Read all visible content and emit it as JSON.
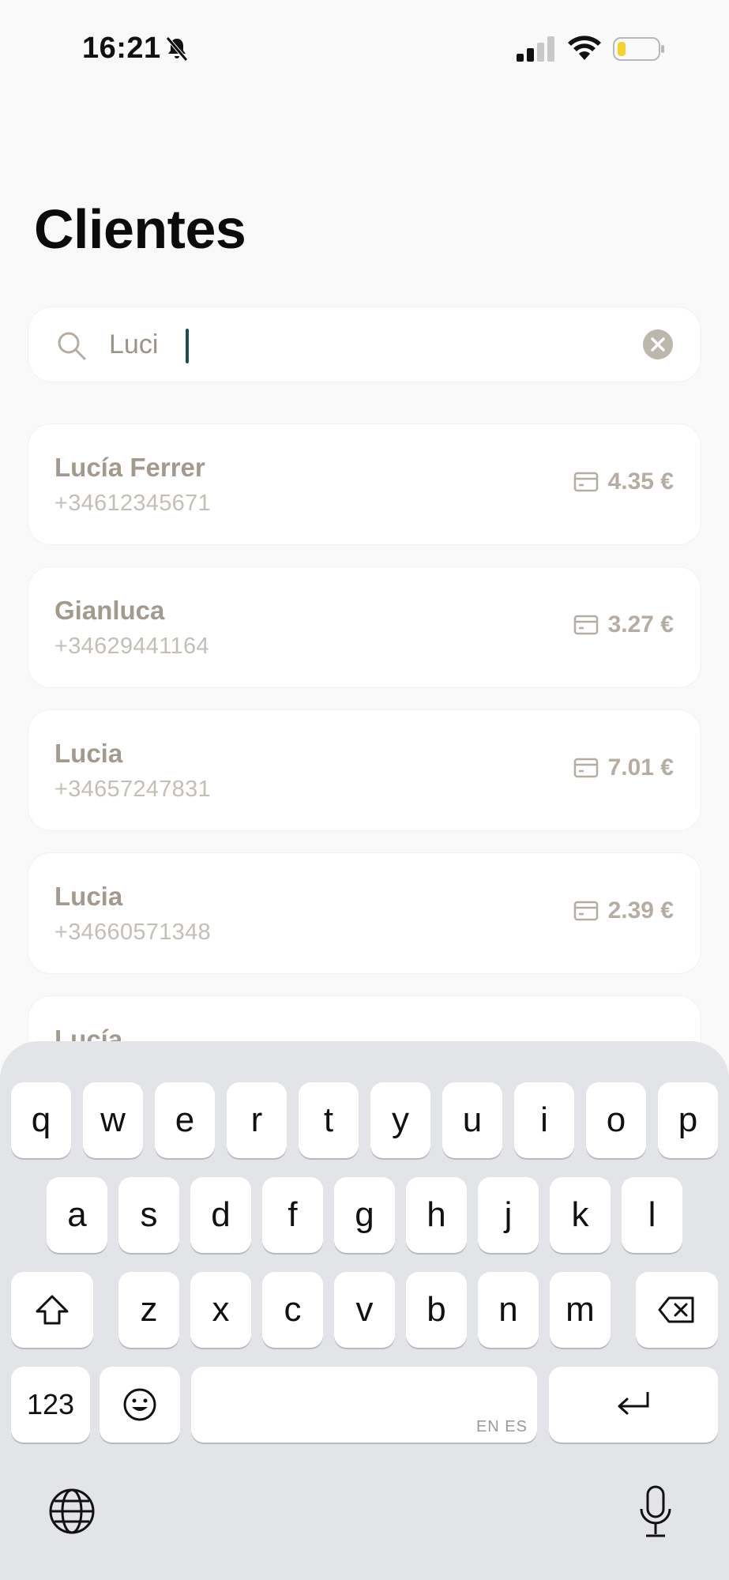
{
  "status_bar": {
    "time": "16:21"
  },
  "page": {
    "title": "Clientes"
  },
  "search": {
    "value": "Luci",
    "placeholder": ""
  },
  "clients": [
    {
      "name": "Lucía Ferrer",
      "phone": "+34612345671",
      "amount": "4.35 €"
    },
    {
      "name": "Gianluca",
      "phone": "+34629441164",
      "amount": "3.27 €"
    },
    {
      "name": "Lucia",
      "phone": "+34657247831",
      "amount": "7.01 €"
    },
    {
      "name": "Lucia",
      "phone": "+34660571348",
      "amount": "2.39 €"
    },
    {
      "name": "Lucía",
      "phone": "",
      "amount": ""
    }
  ],
  "keyboard": {
    "row1": [
      "q",
      "w",
      "e",
      "r",
      "t",
      "y",
      "u",
      "i",
      "o",
      "p"
    ],
    "row2": [
      "a",
      "s",
      "d",
      "f",
      "g",
      "h",
      "j",
      "k",
      "l"
    ],
    "row3": [
      "z",
      "x",
      "c",
      "v",
      "b",
      "n",
      "m"
    ],
    "numbers_label": "123",
    "space_hint": "EN ES"
  },
  "colors": {
    "accent": "#17504e",
    "muted_text": "#a39a8d"
  },
  "icons": [
    "bell-slash-icon",
    "signal-icon",
    "wifi-icon",
    "battery-icon",
    "search-icon",
    "clear-icon",
    "card-icon",
    "shift-icon",
    "backspace-icon",
    "emoji-icon",
    "return-icon",
    "globe-icon",
    "microphone-icon"
  ]
}
